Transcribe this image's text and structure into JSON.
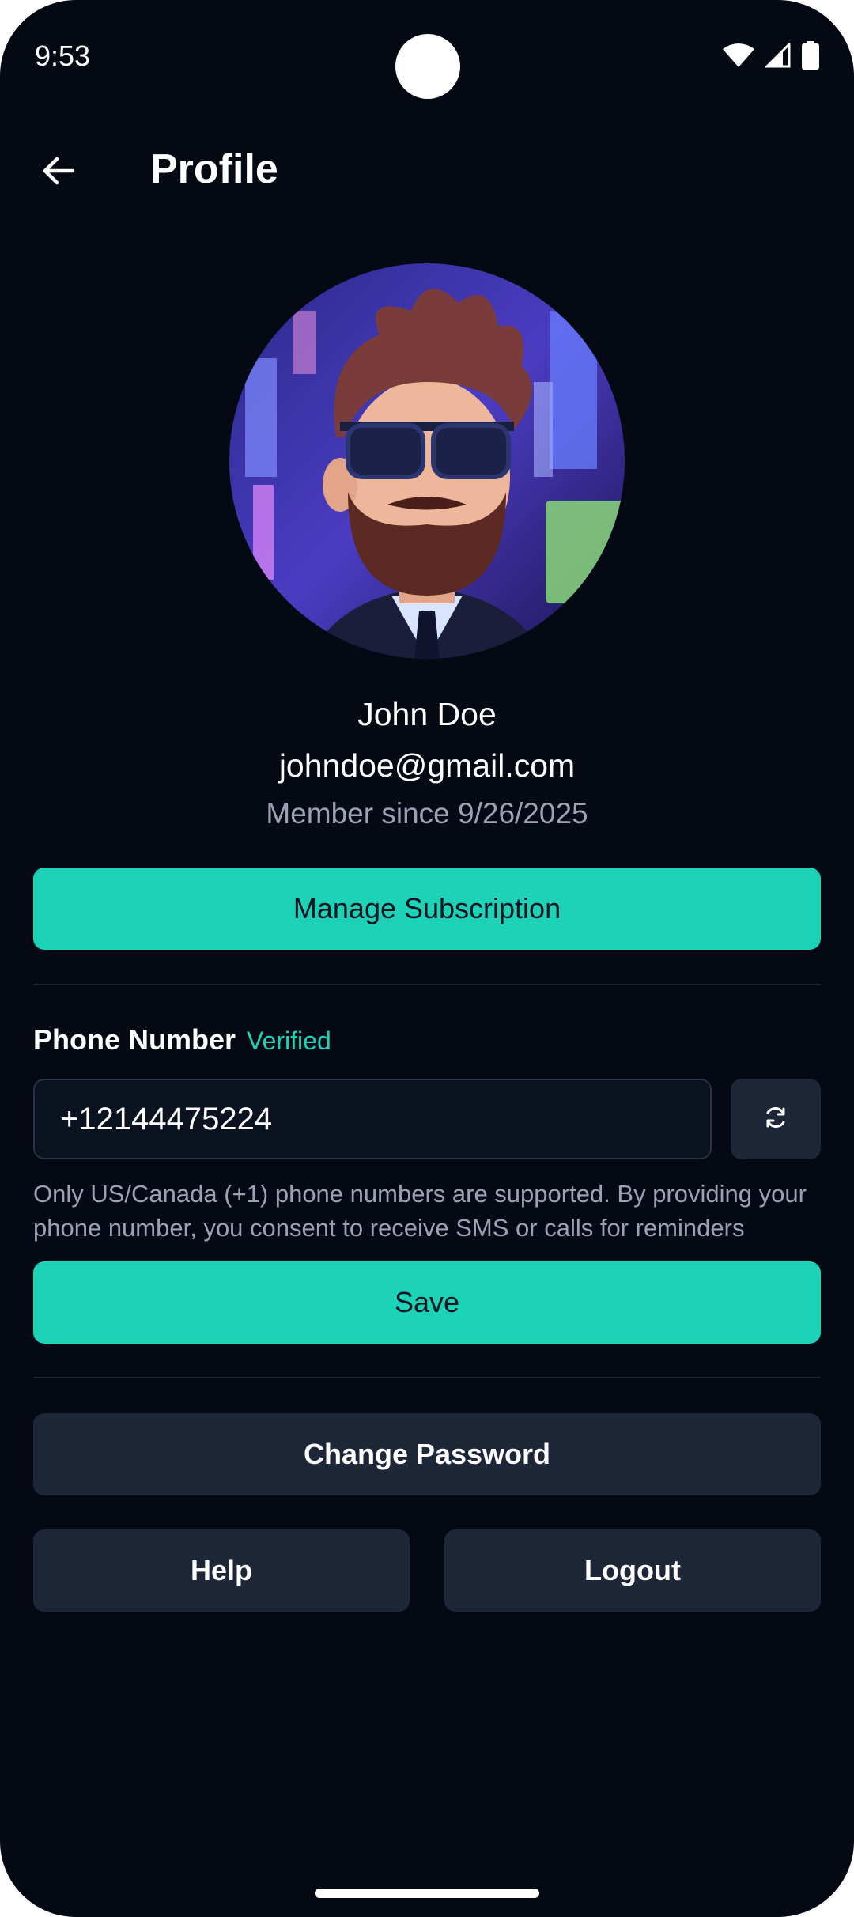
{
  "status_bar": {
    "time": "9:53"
  },
  "header": {
    "title": "Profile"
  },
  "profile": {
    "name": "John Doe",
    "email": "johndoe@gmail.com",
    "member_since": "Member since 9/26/2025"
  },
  "buttons": {
    "manage_subscription": "Manage Subscription",
    "save": "Save",
    "change_password": "Change Password",
    "help": "Help",
    "logout": "Logout"
  },
  "phone": {
    "label": "Phone Number",
    "status": "Verified",
    "value": "+12144475224",
    "disclaimer": "Only US/Canada (+1) phone numbers are supported. By providing your phone number, you consent to receive SMS or calls for reminders"
  },
  "icons": {
    "back": "arrow-left-icon",
    "refresh": "refresh-icon",
    "wifi": "wifi-icon",
    "signal": "signal-icon",
    "battery": "battery-icon"
  },
  "colors": {
    "background": "#040914",
    "accent": "#1dd3b7",
    "secondary_button": "#1e2737",
    "muted_text": "#9aa3b3"
  }
}
